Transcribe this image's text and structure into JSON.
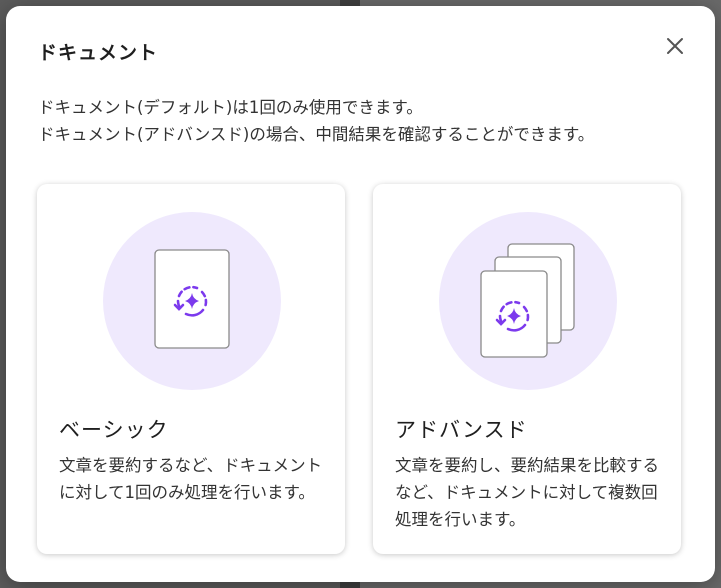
{
  "dialog": {
    "title": "ドキュメント",
    "close_label": "×",
    "description_line1": "ドキュメント(デフォルト)は1回のみ使用できます。",
    "description_line2": "ドキュメント(アドバンスド)の場合、中間結果を確認することができます。"
  },
  "options": [
    {
      "title": "ベーシック",
      "description": "文章を要約するなど、ドキュメントに対して1回のみ処理を行います。",
      "icon": "single-document-sparkle-icon"
    },
    {
      "title": "アドバンスド",
      "description": "文章を要約し、要約結果を比較するなど、ドキュメントに対して複数回処理を行います。",
      "icon": "stacked-documents-sparkle-icon"
    }
  ],
  "colors": {
    "accent": "#7c3aed",
    "illustration_bg": "#efe9fd",
    "text": "#1f1f1f"
  }
}
